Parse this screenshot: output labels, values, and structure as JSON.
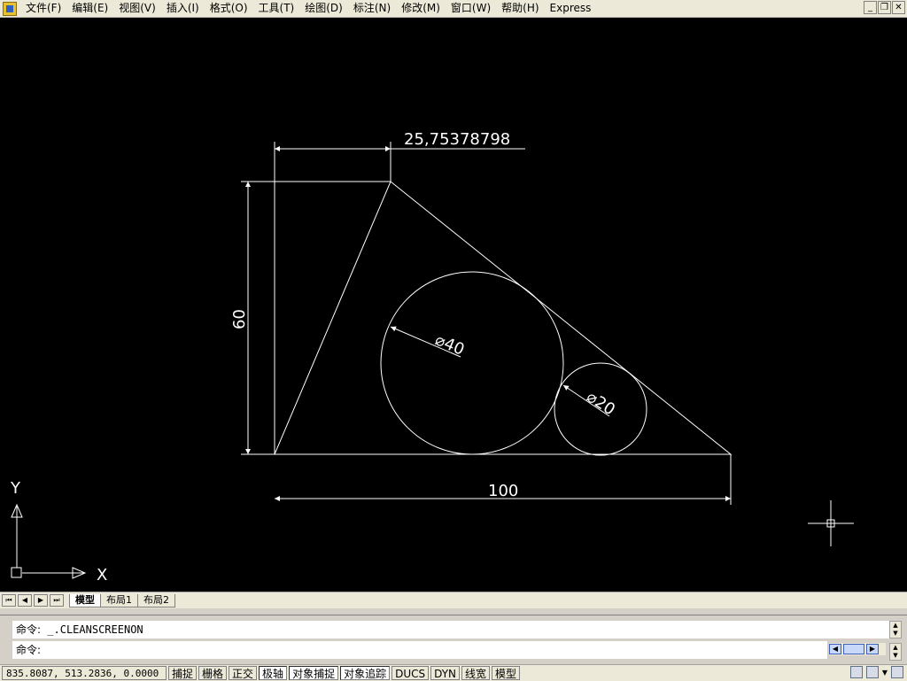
{
  "menu": {
    "items": [
      "文件(F)",
      "编辑(E)",
      "视图(V)",
      "插入(I)",
      "格式(O)",
      "工具(T)",
      "绘图(D)",
      "标注(N)",
      "修改(M)",
      "窗口(W)",
      "帮助(H)",
      "Express"
    ]
  },
  "window_controls": {
    "minimize": "_",
    "restore": "❐",
    "close": "✕"
  },
  "drawing": {
    "top_dimension": "25,75378798",
    "left_dimension": "60",
    "bottom_dimension": "100",
    "large_circle_label": "⌀40",
    "small_circle_label": "⌀20",
    "ucs_x": "X",
    "ucs_y": "Y"
  },
  "layout_tabs": {
    "nav": [
      "⏮",
      "◀",
      "▶",
      "⏭"
    ],
    "tabs": [
      "模型",
      "布局1",
      "布局2"
    ]
  },
  "command": {
    "history_prefix": "命令:",
    "history_text": "_.CLEANSCREENON",
    "prompt": "命令:"
  },
  "status": {
    "coordinates": "835.8087, 513.2836, 0.0000",
    "toggles": [
      "捕捉",
      "栅格",
      "正交",
      "极轴",
      "对象捕捉",
      "对象追踪",
      "DUCS",
      "DYN",
      "线宽",
      "模型"
    ]
  },
  "colors": {
    "canvas": "#000000",
    "geometry": "#ffffff",
    "chrome": "#ece9d8"
  }
}
